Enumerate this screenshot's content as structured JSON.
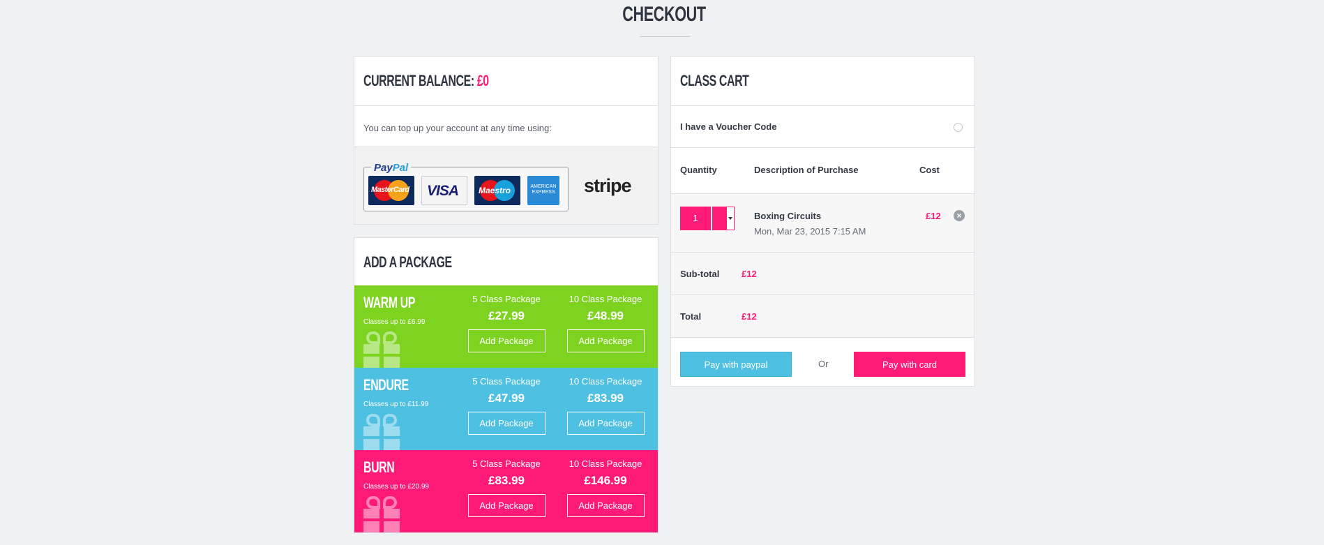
{
  "page": {
    "title": "CHECKOUT"
  },
  "balance": {
    "heading": "CURRENT BALANCE:",
    "amount": "£0",
    "topup_text": "You can top up your account at any time using:",
    "paypal_label_1": "Pay",
    "paypal_label_2": "Pal",
    "cards": {
      "mastercard": "MasterCard",
      "visa": "VISA",
      "maestro": "Maestro",
      "amex": "AMERICAN EXPRESS"
    },
    "stripe": "stripe"
  },
  "packages": {
    "heading": "ADD A PACKAGE",
    "items": [
      {
        "name": "WARM UP",
        "subtitle": "Classes up to £6.99",
        "color": "#7ed321",
        "options": [
          {
            "label": "5 Class Package",
            "price": "£27.99",
            "button": "Add Package"
          },
          {
            "label": "10 Class Package",
            "price": "£48.99",
            "button": "Add Package"
          }
        ]
      },
      {
        "name": "ENDURE",
        "subtitle": "Classes up to £11.99",
        "color": "#4ec0e2",
        "options": [
          {
            "label": "5 Class Package",
            "price": "£47.99",
            "button": "Add Package"
          },
          {
            "label": "10 Class Package",
            "price": "£83.99",
            "button": "Add Package"
          }
        ]
      },
      {
        "name": "BURN",
        "subtitle": "Classes up to £20.99",
        "color": "#ff1a78",
        "options": [
          {
            "label": "5 Class Package",
            "price": "£83.99",
            "button": "Add Package"
          },
          {
            "label": "10 Class Package",
            "price": "£146.99",
            "button": "Add Package"
          }
        ]
      }
    ]
  },
  "cart": {
    "heading": "CLASS CART",
    "voucher_label": "I have a Voucher Code",
    "columns": {
      "quantity": "Quantity",
      "description": "Description of Purchase",
      "cost": "Cost"
    },
    "item": {
      "quantity": "1",
      "name": "Boxing Circuits",
      "date": "Mon, Mar 23, 2015 7:15 AM",
      "cost": "£12"
    },
    "subtotal_label": "Sub-total",
    "subtotal_value": "£12",
    "total_label": "Total",
    "total_value": "£12",
    "pay_paypal": "Pay with paypal",
    "or": "Or",
    "pay_card": "Pay with card"
  },
  "colors": {
    "accent": "#ff1a78",
    "paypal_button": "#4ec0e2",
    "warm_up": "#7ed321",
    "endure": "#4ec0e2",
    "burn": "#ff1a78"
  },
  "icons": [
    "paypal-logo-icon",
    "mastercard-icon",
    "visa-icon",
    "maestro-icon",
    "amex-icon",
    "stripe-logo-icon",
    "gift-icon",
    "chevron-down-icon",
    "close-icon",
    "radio-icon"
  ]
}
